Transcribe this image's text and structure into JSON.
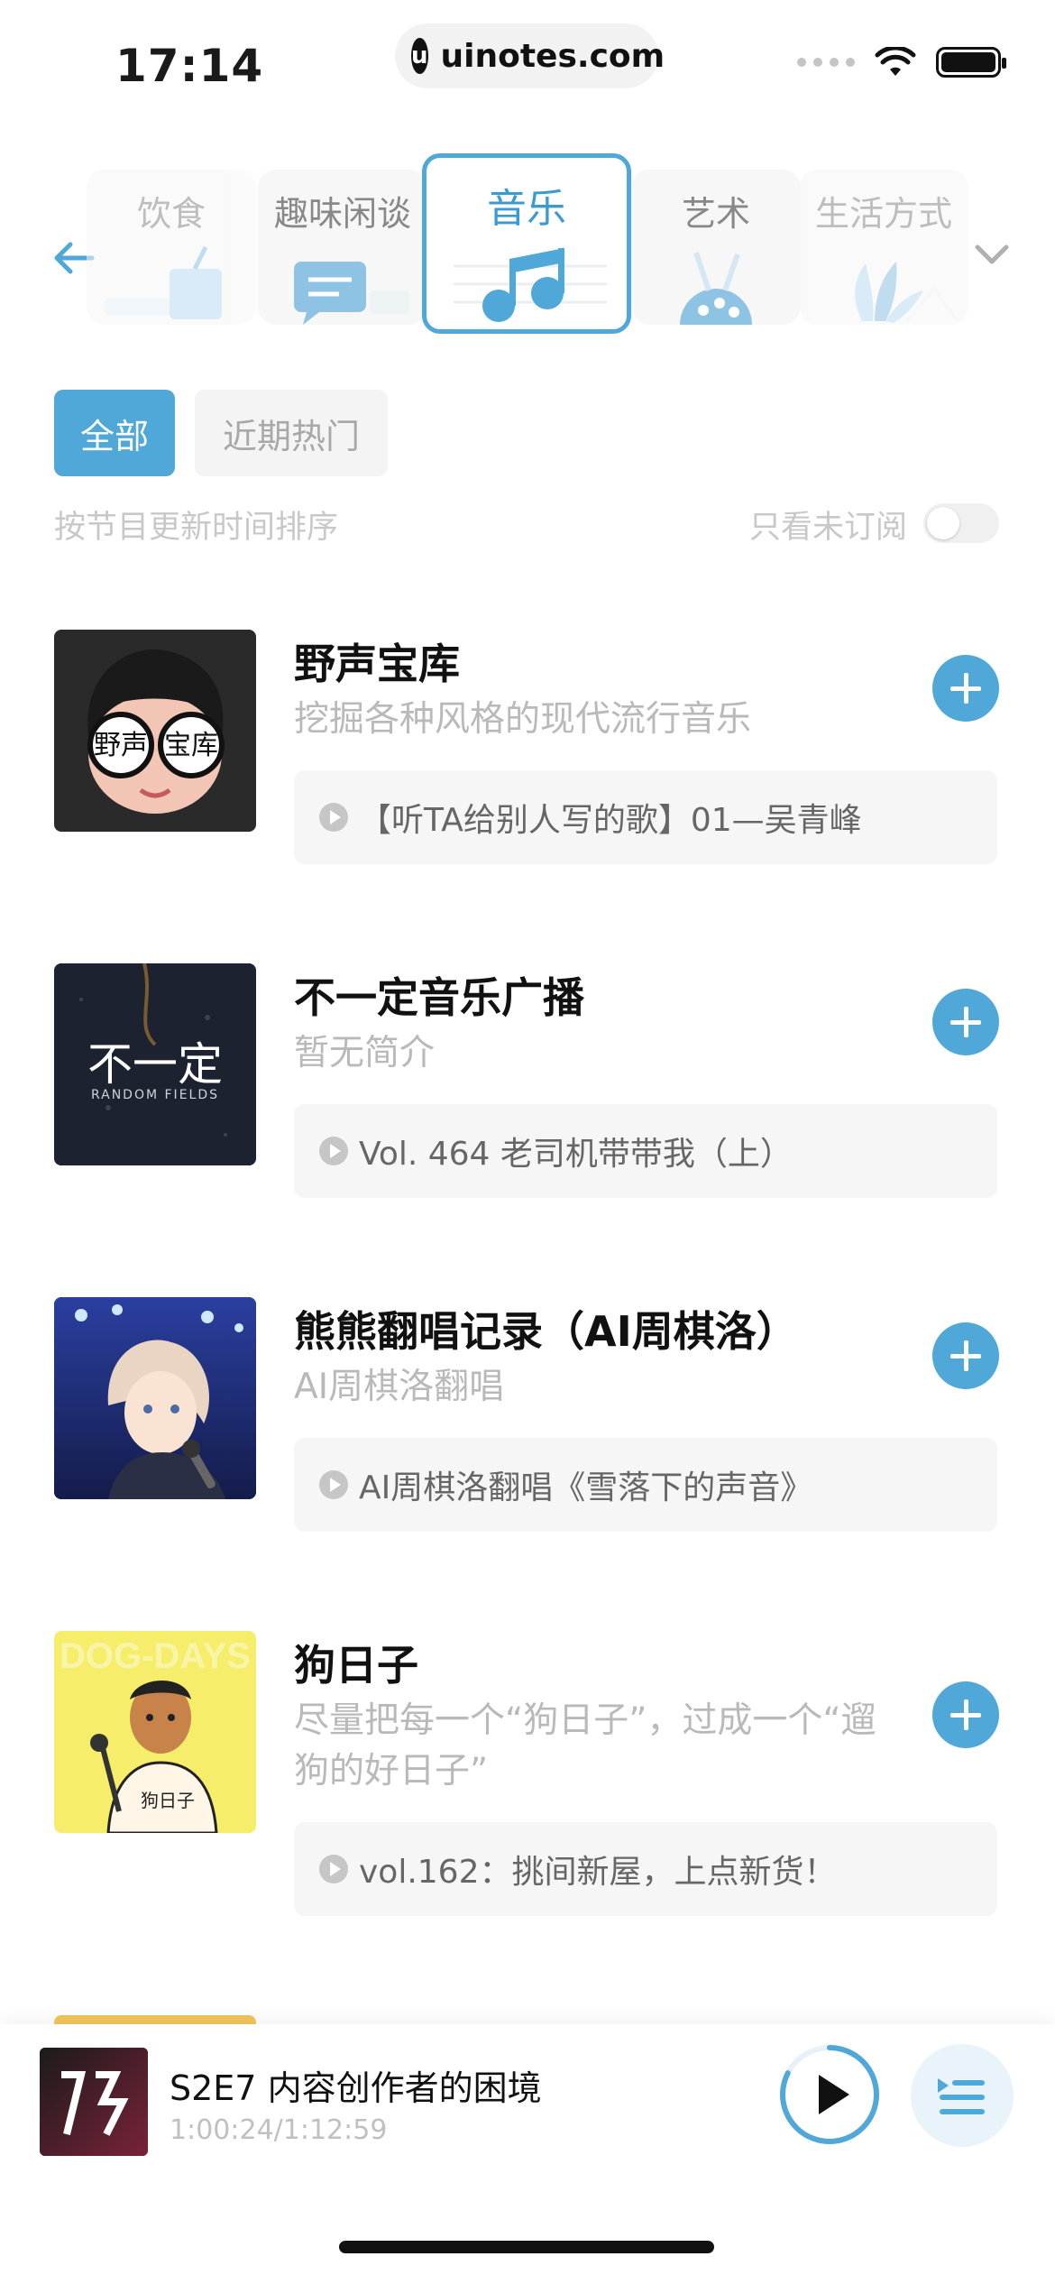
{
  "status_bar": {
    "time": "17:14",
    "url": "uinotes.com"
  },
  "categories": [
    {
      "label": "饮食",
      "state": "faded"
    },
    {
      "label": "趣味闲谈",
      "state": "normal"
    },
    {
      "label": "音乐",
      "state": "active"
    },
    {
      "label": "艺术",
      "state": "normal"
    },
    {
      "label": "生活方式",
      "state": "faded"
    }
  ],
  "filters": {
    "all": "全部",
    "hot": "近期热门"
  },
  "sort_text": "按节目更新时间排序",
  "unsub_text": "只看未订阅",
  "unsub_toggle_on": false,
  "podcasts": [
    {
      "title": "野声宝库",
      "desc": "挖掘各种风格的现代流行音乐",
      "episode": "【听TA给别人写的歌】01—吴青峰",
      "cover_text": "野声宝库"
    },
    {
      "title": "不一定音乐广播",
      "desc": "暂无简介",
      "episode": "Vol. 464 老司机带带我（上）",
      "cover_text": "不一定",
      "cover_sub": "RANDOM FIELDS"
    },
    {
      "title": "熊熊翻唱记录（AI周棋洛）",
      "desc": "AI周棋洛翻唱",
      "episode": "AI周棋洛翻唱《雪落下的声音》"
    },
    {
      "title": "狗日子",
      "desc": "尽量把每一个“狗日子”，过成一个“遛狗的好日子”",
      "episode": "vol.162：挑间新屋，上点新货！",
      "cover_text": "DOG-DAYS",
      "cover_sub": "狗日子"
    }
  ],
  "player": {
    "title": "S2E7 内容创作者的困境",
    "time": "1:00:24/1:12:59",
    "progress": 0.825
  },
  "colors": {
    "accent": "#4fa8d8",
    "muted": "#b9b9b9"
  }
}
